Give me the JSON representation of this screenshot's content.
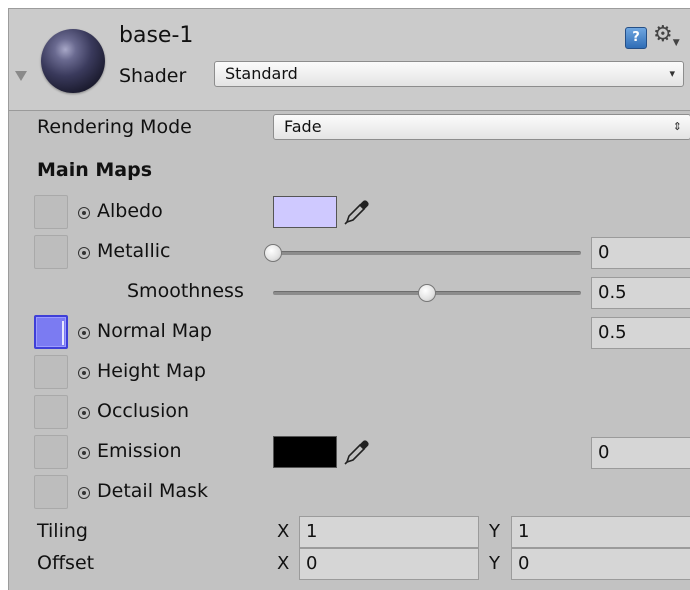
{
  "header": {
    "material_name": "base-1",
    "shader_label": "Shader",
    "shader_value": "Standard",
    "help_icon": "help-book-icon",
    "settings_icon": "gear-icon"
  },
  "rendering": {
    "label": "Rendering Mode",
    "value": "Fade"
  },
  "main_maps": {
    "title": "Main Maps",
    "albedo": {
      "label": "Albedo",
      "color": "#cfc9ff"
    },
    "metallic": {
      "label": "Metallic",
      "value": "0",
      "slider": 0
    },
    "smoothness": {
      "label": "Smoothness",
      "value": "0.5",
      "slider": 0.5
    },
    "normal_map": {
      "label": "Normal Map",
      "value": "0.5",
      "texture_color": "#7b7bf2"
    },
    "height_map": {
      "label": "Height Map"
    },
    "occlusion": {
      "label": "Occlusion"
    },
    "emission": {
      "label": "Emission",
      "color": "#000000",
      "value": "0"
    },
    "detail_mask": {
      "label": "Detail Mask"
    }
  },
  "tiling": {
    "label": "Tiling",
    "x_label": "X",
    "x": "1",
    "y_label": "Y",
    "y": "1"
  },
  "offset": {
    "label": "Offset",
    "x_label": "X",
    "x": "0",
    "y_label": "Y",
    "y": "0"
  }
}
